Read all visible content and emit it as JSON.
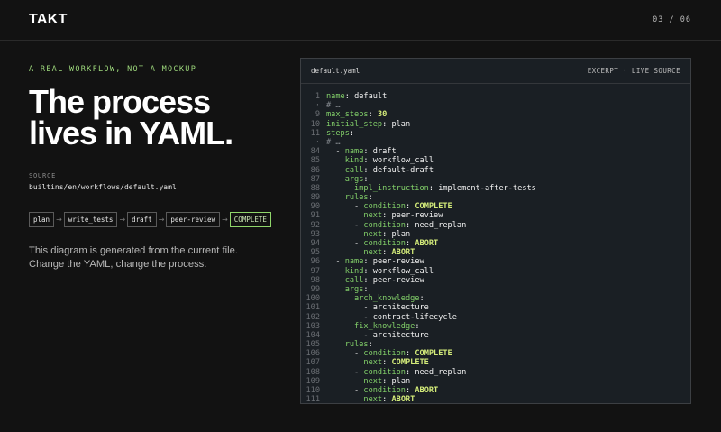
{
  "header": {
    "logo": "TAKT",
    "pager": "03 / 06"
  },
  "hero": {
    "eyebrow": "A REAL WORKFLOW, NOT A MOCKUP",
    "headline_line1": "The process",
    "headline_line2": "lives in YAML.",
    "source_label": "SOURCE",
    "source_path": "builtins/en/workflows/default.yaml",
    "flow": [
      "plan",
      "write_tests",
      "draft",
      "peer-review",
      "COMPLETE"
    ],
    "flow_arrow": "→",
    "description_line1": "This diagram is generated from the current file.",
    "description_line2": "Change the YAML, change the process."
  },
  "panel": {
    "filename": "default.yaml",
    "tag": "EXCERPT · LIVE SOURCE",
    "lines": [
      {
        "n": "1",
        "indent": 0,
        "dash": false,
        "key": "name",
        "val": "default",
        "vt": "s"
      },
      {
        "n": "·",
        "comment": "# …"
      },
      {
        "n": "9",
        "indent": 0,
        "dash": false,
        "key": "max_steps",
        "val": "30",
        "vt": "c"
      },
      {
        "n": "10",
        "indent": 0,
        "dash": false,
        "key": "initial_step",
        "val": "plan",
        "vt": "s"
      },
      {
        "n": "11",
        "indent": 0,
        "dash": false,
        "key": "steps",
        "val": "",
        "vt": "s"
      },
      {
        "n": "·",
        "comment": "# …"
      },
      {
        "n": "84",
        "indent": 1,
        "dash": true,
        "key": "name",
        "val": "draft",
        "vt": "s"
      },
      {
        "n": "85",
        "indent": 2,
        "dash": false,
        "key": "kind",
        "val": "workflow_call",
        "vt": "s"
      },
      {
        "n": "86",
        "indent": 2,
        "dash": false,
        "key": "call",
        "val": "default-draft",
        "vt": "s"
      },
      {
        "n": "87",
        "indent": 2,
        "dash": false,
        "key": "args",
        "val": "",
        "vt": "s"
      },
      {
        "n": "88",
        "indent": 3,
        "dash": false,
        "key": "impl_instruction",
        "val": "implement-after-tests",
        "vt": "s"
      },
      {
        "n": "89",
        "indent": 2,
        "dash": false,
        "key": "rules",
        "val": "",
        "vt": "s"
      },
      {
        "n": "90",
        "indent": 3,
        "dash": true,
        "key": "condition",
        "val": "COMPLETE",
        "vt": "c"
      },
      {
        "n": "91",
        "indent": 4,
        "dash": false,
        "key": "next",
        "val": "peer-review",
        "vt": "s"
      },
      {
        "n": "92",
        "indent": 3,
        "dash": true,
        "key": "condition",
        "val": "need_replan",
        "vt": "s"
      },
      {
        "n": "93",
        "indent": 4,
        "dash": false,
        "key": "next",
        "val": "plan",
        "vt": "s"
      },
      {
        "n": "94",
        "indent": 3,
        "dash": true,
        "key": "condition",
        "val": "ABORT",
        "vt": "c"
      },
      {
        "n": "95",
        "indent": 4,
        "dash": false,
        "key": "next",
        "val": "ABORT",
        "vt": "c"
      },
      {
        "n": "96",
        "indent": 1,
        "dash": true,
        "key": "name",
        "val": "peer-review",
        "vt": "s"
      },
      {
        "n": "97",
        "indent": 2,
        "dash": false,
        "key": "kind",
        "val": "workflow_call",
        "vt": "s"
      },
      {
        "n": "98",
        "indent": 2,
        "dash": false,
        "key": "call",
        "val": "peer-review",
        "vt": "s"
      },
      {
        "n": "99",
        "indent": 2,
        "dash": false,
        "key": "args",
        "val": "",
        "vt": "s"
      },
      {
        "n": "100",
        "indent": 3,
        "dash": false,
        "key": "arch_knowledge",
        "val": "",
        "vt": "s"
      },
      {
        "n": "101",
        "indent": 4,
        "dash": true,
        "key": "",
        "val": "architecture",
        "vt": "s"
      },
      {
        "n": "102",
        "indent": 4,
        "dash": true,
        "key": "",
        "val": "contract-lifecycle",
        "vt": "s"
      },
      {
        "n": "103",
        "indent": 3,
        "dash": false,
        "key": "fix_knowledge",
        "val": "",
        "vt": "s"
      },
      {
        "n": "104",
        "indent": 4,
        "dash": true,
        "key": "",
        "val": "architecture",
        "vt": "s"
      },
      {
        "n": "105",
        "indent": 2,
        "dash": false,
        "key": "rules",
        "val": "",
        "vt": "s"
      },
      {
        "n": "106",
        "indent": 3,
        "dash": true,
        "key": "condition",
        "val": "COMPLETE",
        "vt": "c"
      },
      {
        "n": "107",
        "indent": 4,
        "dash": false,
        "key": "next",
        "val": "COMPLETE",
        "vt": "c"
      },
      {
        "n": "108",
        "indent": 3,
        "dash": true,
        "key": "condition",
        "val": "need_replan",
        "vt": "s"
      },
      {
        "n": "109",
        "indent": 4,
        "dash": false,
        "key": "next",
        "val": "plan",
        "vt": "s"
      },
      {
        "n": "110",
        "indent": 3,
        "dash": true,
        "key": "condition",
        "val": "ABORT",
        "vt": "c"
      },
      {
        "n": "111",
        "indent": 4,
        "dash": false,
        "key": "next",
        "val": "ABORT",
        "vt": "c"
      }
    ]
  }
}
